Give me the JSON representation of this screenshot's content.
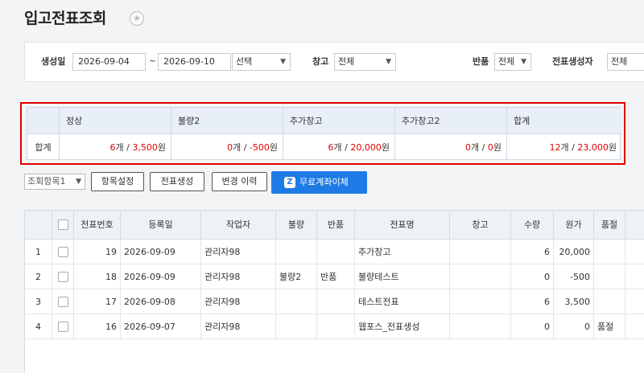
{
  "page": {
    "title": "입고전표조회"
  },
  "filters": {
    "created_label": "생성일",
    "date_from": "2026-09-04",
    "tilde": "~",
    "date_to": "2026-09-10",
    "range_select": "선택",
    "warehouse_label": "창고",
    "warehouse_value": "전체",
    "return_label": "반품",
    "return_value": "전체",
    "creator_label": "전표생성자",
    "creator_value": "전체"
  },
  "summary": {
    "row_label": "합계",
    "columns": [
      {
        "header": "정상",
        "count": "6",
        "amount": "3,500"
      },
      {
        "header": "불량2",
        "count": "0",
        "amount": "-500"
      },
      {
        "header": "추가창고",
        "count": "6",
        "amount": "20,000"
      },
      {
        "header": "추가창고2",
        "count": "0",
        "amount": "0"
      },
      {
        "header": "합계",
        "count": "12",
        "amount": "23,000"
      }
    ],
    "count_unit": "개",
    "amount_unit": "원",
    "separator": " / "
  },
  "toolbar": {
    "view_select": "조회항목1",
    "item_settings": "항목설정",
    "create_slip": "전표생성",
    "change_history": "변경 이력",
    "free_transfer": "무료계좌이체"
  },
  "table": {
    "headers": [
      "전표번호",
      "등록일",
      "작업자",
      "불량",
      "반품",
      "전표명",
      "창고",
      "수량",
      "원가",
      "품절"
    ],
    "rows": [
      {
        "no": "1",
        "slip": "19",
        "date": "2026-09-09",
        "worker": "관리자98",
        "defect": "",
        "ret": "",
        "name": "추가창고",
        "wh": "",
        "qty": "6",
        "cost": "20,000",
        "sold": ""
      },
      {
        "no": "2",
        "slip": "18",
        "date": "2026-09-09",
        "worker": "관리자98",
        "defect": "불량2",
        "ret": "반품",
        "name": "불량테스트",
        "wh": "",
        "qty": "0",
        "cost": "-500",
        "sold": ""
      },
      {
        "no": "3",
        "slip": "17",
        "date": "2026-09-08",
        "worker": "관리자98",
        "defect": "",
        "ret": "",
        "name": "테스트전표",
        "wh": "",
        "qty": "6",
        "cost": "3,500",
        "sold": ""
      },
      {
        "no": "4",
        "slip": "16",
        "date": "2026-09-07",
        "worker": "관리자98",
        "defect": "",
        "ret": "",
        "name": "웹포스_전표생성",
        "wh": "",
        "qty": "0",
        "cost": "0",
        "sold": "품절"
      }
    ]
  },
  "colors": {
    "accent": "#1e7be6",
    "highlight": "#e00000"
  }
}
